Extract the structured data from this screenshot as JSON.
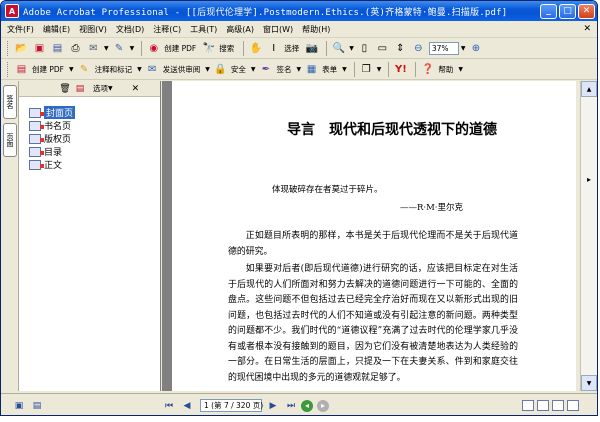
{
  "window": {
    "title": "Adobe Acrobat Professional - [[后现代伦理学].Postmodern.Ethics.(英)齐格蒙特·鲍曼.扫描版.pdf]",
    "app_icon": "A"
  },
  "menu": [
    "文件(F)",
    "编辑(E)",
    "视图(V)",
    "文档(D)",
    "注释(C)",
    "工具(T)",
    "高级(A)",
    "窗口(W)",
    "帮助(H)"
  ],
  "toolbar1": {
    "labels": {
      "create": "创建 PDF",
      "search": "搜索",
      "select": "选择"
    },
    "zoom": "37%"
  },
  "toolbar2": {
    "create_pdf": "创建 PDF",
    "comment_markup": "注释和标记",
    "send_review": "发送供审阅",
    "secure": "安全",
    "sign": "签名",
    "forms": "表单",
    "help": "帮助"
  },
  "nav_tabs": [
    "签名",
    "页面"
  ],
  "bookmarks": {
    "options": "选项",
    "items": [
      {
        "label": "封面页",
        "selected": true
      },
      {
        "label": "书名页",
        "selected": false
      },
      {
        "label": "版权页",
        "selected": false
      },
      {
        "label": "目录",
        "selected": false
      },
      {
        "label": "正文",
        "selected": false
      }
    ]
  },
  "document": {
    "chapter_title": "导言　现代和后现代透视下的道德",
    "epigraph": "体现破碎存在者莫过于碎片。",
    "epigraph_author": "——R·M·里尔克",
    "paragraphs": [
      "正如题目所表明的那样，本书是关于后现代伦理而不是关于后现代道德的研究。",
      "如果要对后者(即后现代道德)进行研究的话，应该把目标定在对生活于后现代的人们所面对和努力去解决的道德问题进行一下可能的、全面的盘点。这些问题不但包括过去已经完全疗治好而现在又以新形式出现的旧问题，也包括过去时代的人们不知道或没有引起注意的新问题。两种类型的问题都不少。我们时代的“道德议程”充满了过去时代的伦理学家几乎没有或者根本没有接触到的题目，因为它们没有被清楚地表达为人类经验的一部分。在日常生活的层面上，只提及一下在夫妻关系、件到和家庭交往的现代困境中出现的多元的道德观就足够了。"
    ]
  },
  "status": {
    "page_indicator": "1 (第 7 / 320 页)"
  }
}
